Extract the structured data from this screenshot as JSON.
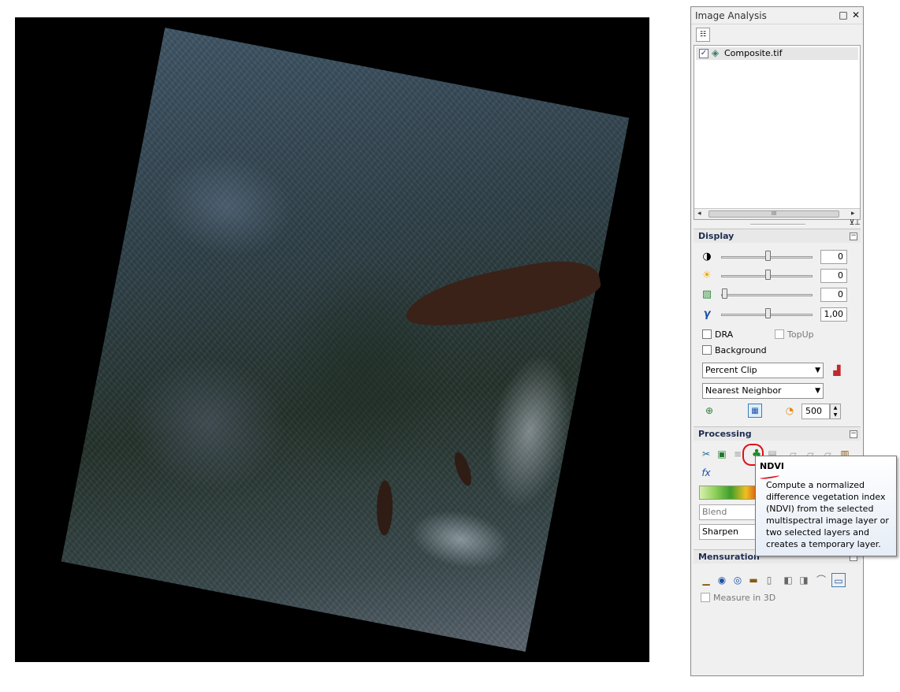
{
  "panel": {
    "title": "Image Analysis",
    "restore_glyph": "□",
    "close_glyph": "✕"
  },
  "layers": {
    "items": [
      {
        "name": "Composite.tif",
        "checked": true
      }
    ],
    "scroll_grip": "III"
  },
  "display": {
    "section_label": "Display",
    "contrast_value": "0",
    "brightness_value": "0",
    "transparency_value": "0",
    "gamma_value": "1,00",
    "dra_label": "DRA",
    "topup_label": "TopUp",
    "background_label": "Background",
    "stretch_selected": "Percent Clip",
    "resample_selected": "Nearest Neighbor",
    "refresh_value": "500"
  },
  "processing": {
    "section_label": "Processing",
    "blend_selected": "Blend",
    "sharpen_selected": "Sharpen"
  },
  "tooltip": {
    "title": "NDVI",
    "body": "Compute a normalized difference vegetation index (NDVI) from the selected multispectral image layer or two selected layers and creates a temporary layer."
  },
  "mensuration": {
    "section_label": "Mensuration",
    "measure3d_label": "Measure in 3D"
  },
  "colors": {
    "annotation": "#e0101a",
    "section_title": "#1e2d50",
    "lake": "#3a2218"
  }
}
